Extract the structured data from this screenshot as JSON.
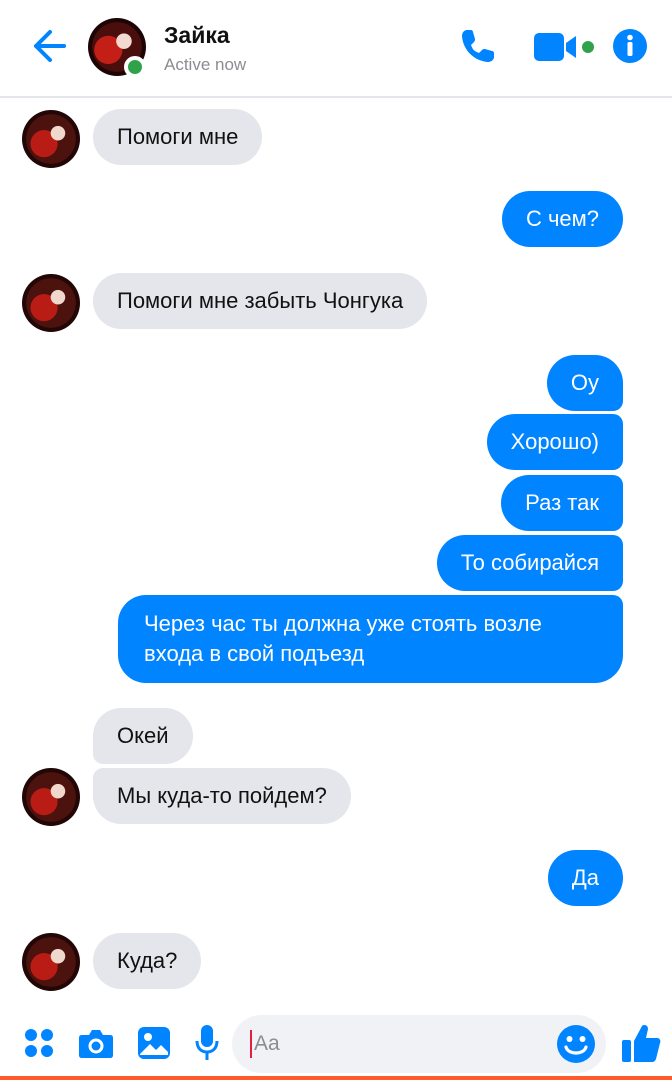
{
  "header": {
    "contact_name": "Зайка",
    "status": "Active now"
  },
  "messages": [
    {
      "from": "contact",
      "text": "Помоги мне"
    },
    {
      "from": "me",
      "text": "С чем?"
    },
    {
      "from": "contact",
      "text": "Помоги мне забыть Чонгука"
    },
    {
      "from": "me",
      "text": "Оу"
    },
    {
      "from": "me",
      "text": "Хорошо)"
    },
    {
      "from": "me",
      "text": "Раз так"
    },
    {
      "from": "me",
      "text": "То собирайся"
    },
    {
      "from": "me",
      "text": "Через час ты должна уже стоять возле входа в свой подъезд"
    },
    {
      "from": "contact",
      "text": "Окей"
    },
    {
      "from": "contact",
      "text": "Мы куда-то пойдем?"
    },
    {
      "from": "me",
      "text": "Да"
    },
    {
      "from": "contact",
      "text": "Куда?"
    }
  ],
  "composer": {
    "placeholder": "Aa",
    "icons": [
      "apps-icon",
      "camera-icon",
      "gallery-icon",
      "microphone-icon",
      "emoji-icon",
      "like-icon"
    ]
  },
  "colors": {
    "accent": "#0084ff",
    "incoming_bubble": "#e4e6eb",
    "online": "#31a24c",
    "bottom_bar": "#ff5b2e"
  }
}
